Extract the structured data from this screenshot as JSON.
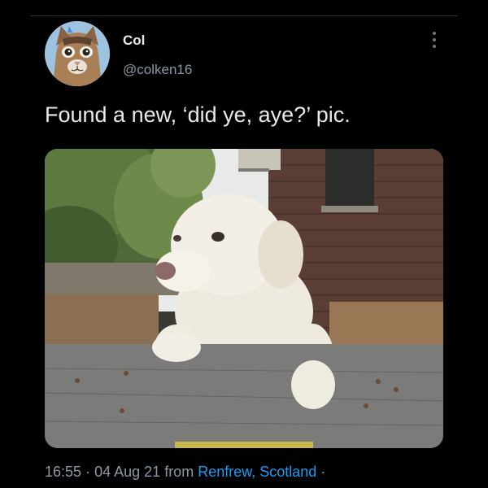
{
  "tweet": {
    "author_name": "Col",
    "author_handle": "@colken16",
    "text": "Found a new, ‘did ye, aye?’ pic.",
    "time": "16:55",
    "separator": "·",
    "date": "04 Aug 21",
    "from_label": "from",
    "location": "Renfrew, Scotland",
    "trailing_separator": "·"
  },
  "colors": {
    "background": "#000000",
    "text_primary": "#e7e9ea",
    "text_secondary": "#8b98a5",
    "link": "#1d9bf0"
  },
  "icons": {
    "more": "more-vertical-icon"
  }
}
